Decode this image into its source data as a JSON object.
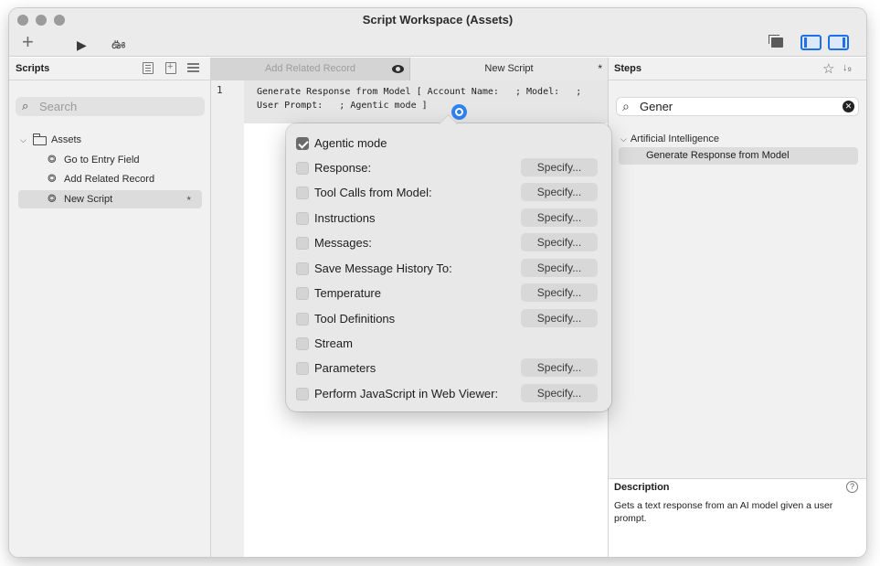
{
  "window": {
    "title": "Script Workspace (Assets)"
  },
  "toolbar": {
    "add_icon": "+",
    "run_icon": "▶",
    "debug_icon": "ఊ"
  },
  "sidebar": {
    "title": "Scripts",
    "search_placeholder": "Search",
    "folder": {
      "label": "Assets",
      "expanded": true
    },
    "items": [
      {
        "label": "Go to Entry Field",
        "selected": false,
        "modified": ""
      },
      {
        "label": "Add Related Record",
        "selected": false,
        "modified": ""
      },
      {
        "label": "New Script",
        "selected": true,
        "modified": "*"
      }
    ]
  },
  "editor": {
    "tabs": [
      {
        "label": "Add Related Record",
        "active": false
      },
      {
        "label": "New Script",
        "active": true,
        "modified": "*"
      }
    ],
    "line_number": "1",
    "step_line1": "Generate Response from Model [ Account Name:   ; Model:   ;",
    "step_line2": "User Prompt:   ; Agentic mode ]"
  },
  "popover": {
    "options": [
      {
        "label": "Agentic mode",
        "checked": true,
        "button": ""
      },
      {
        "label": "Response:",
        "checked": false,
        "button": "Specify..."
      },
      {
        "label": "Tool Calls from Model:",
        "checked": false,
        "button": "Specify..."
      },
      {
        "label": "Instructions",
        "checked": false,
        "button": "Specify..."
      },
      {
        "label": "Messages:",
        "checked": false,
        "button": "Specify..."
      },
      {
        "label": "Save Message History To:",
        "checked": false,
        "button": "Specify..."
      },
      {
        "label": "Temperature",
        "checked": false,
        "button": "Specify..."
      },
      {
        "label": "Tool Definitions",
        "checked": false,
        "button": "Specify..."
      },
      {
        "label": "Stream",
        "checked": false,
        "button": ""
      },
      {
        "label": "Parameters",
        "checked": false,
        "button": "Specify..."
      },
      {
        "label": "Perform JavaScript in Web Viewer:",
        "checked": false,
        "button": "Specify..."
      }
    ]
  },
  "steps": {
    "title": "Steps",
    "search_value": "Gener",
    "category": "Artificial Intelligence",
    "item": "Generate Response from Model",
    "description_title": "Description",
    "description_text": "Gets a text response from an AI model given a user prompt."
  },
  "colors": {
    "accent": "#2f82f0",
    "selected": "#dcdcdc",
    "panel": "#f1f1f1"
  }
}
